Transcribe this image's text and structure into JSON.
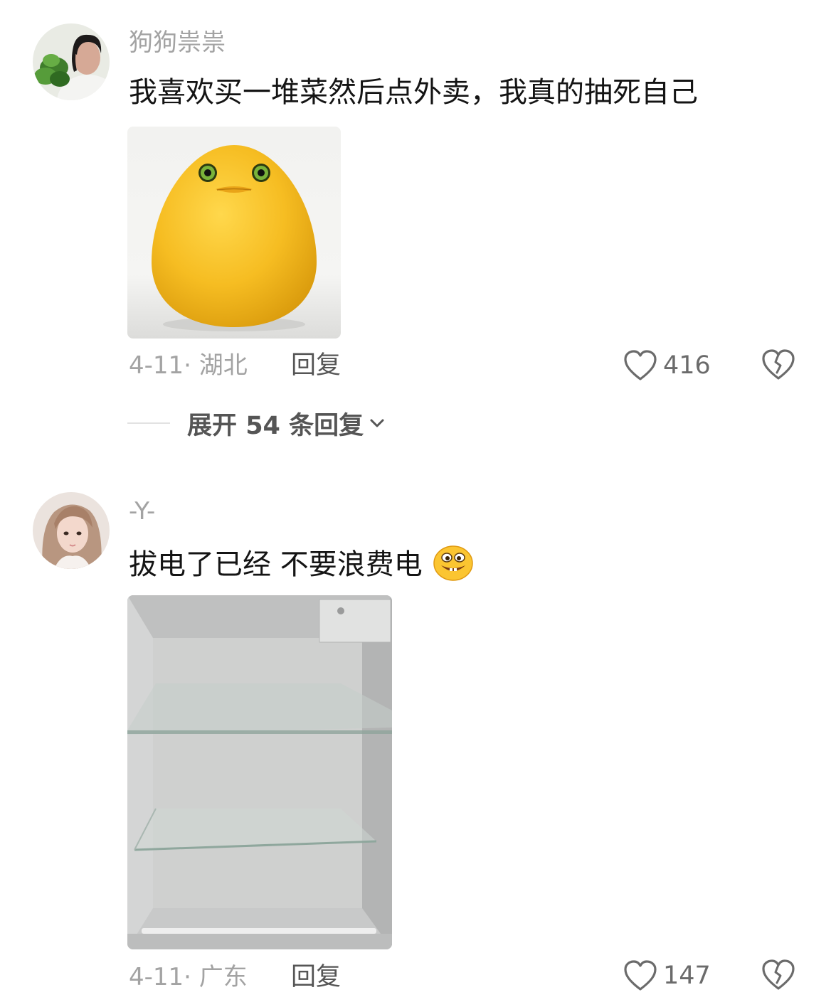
{
  "comments": [
    {
      "username": "狗狗祟祟",
      "text": "我喜欢买一堆菜然后点外卖，我真的抽死自己",
      "date": "4-11",
      "separator": "·",
      "location": "湖北",
      "reply_label": "回复",
      "likes": "416",
      "image_icon": "yellow-egg-creature",
      "avatar_icon": "person-with-vegetables"
    },
    {
      "username": "-Y-",
      "text": "拔电了已经 不要浪费电",
      "emoji": "grinning-face-emoji",
      "date": "4-11",
      "separator": "·",
      "location": "广东",
      "reply_label": "回复",
      "likes": "147",
      "image_icon": "empty-fridge",
      "avatar_icon": "girl-portrait"
    }
  ],
  "expand": {
    "prefix": "展开",
    "count": "54",
    "suffix": "条回复"
  },
  "colors": {
    "background": "#ffffff",
    "muted_text": "#a3a3a3",
    "primary_text": "#141414",
    "egg_yellow": "#f6bd22"
  }
}
